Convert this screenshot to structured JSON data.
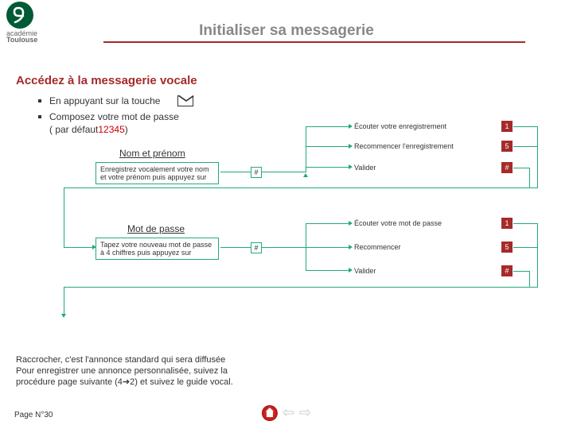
{
  "logo": {
    "line1": "académie",
    "line2": "Toulouse"
  },
  "title": "Initialiser sa messagerie",
  "subhead": "Accédez à la messagerie vocale",
  "bullets": {
    "b1": "En appuyant sur la touche",
    "b2": "Composez votre mot de passe",
    "b2_sub_pre": "( par défaut ",
    "b2_sub_num": "12345",
    "b2_sub_post": ")"
  },
  "section1": {
    "title": "Nom et prénom",
    "box": "Enregistrez vocalement votre nom et votre prénom puis appuyez sur",
    "hash": "#",
    "opt1": "Écouter votre enregistrement",
    "opt2": "Recommencer l'enregistrement",
    "opt3": "Valider",
    "k1": "1",
    "k2": "5",
    "k3": "#"
  },
  "section2": {
    "title": "Mot de passe",
    "box": "Tapez votre nouveau mot de passe à 4 chiffres puis appuyez sur",
    "hash": "#",
    "opt1": "Écouter votre mot de passe",
    "opt2": "Recommencer",
    "opt3": "Valider",
    "k1": "1",
    "k2": "5",
    "k3": "#"
  },
  "final": {
    "l1": "Raccrocher, c'est l'annonce standard qui sera diffusée",
    "l2": "Pour enregistrer une annonce personnalisée, suivez la",
    "l3_pre": "procédure page suivante (4",
    "l3_arrow": "➔",
    "l3_post": "2) et suivez le guide vocal."
  },
  "footer": "Page N°30"
}
